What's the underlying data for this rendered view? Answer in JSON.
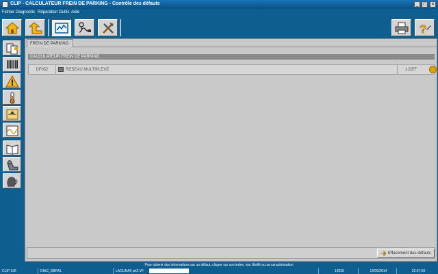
{
  "window": {
    "title": "CLIP - CALCULATEUR FREIN DE PARKING - Contrôle des défauts",
    "minimize": "_",
    "maximize": "□",
    "close": "×"
  },
  "menu": [
    "Fichier",
    "Diagnostic",
    "Réparation",
    "Outils",
    "Aide"
  ],
  "toolbar": {
    "icons": [
      "home-icon",
      "up-arrow-icon",
      "chart-icon",
      "probe-icon",
      "tools-icon",
      "printer-icon",
      "help-icon"
    ],
    "active": "chart-icon"
  },
  "sidebar": {
    "icons": [
      "documents-icon",
      "barcode-icon",
      "warning-icon",
      "thermometer-icon",
      "parameters-icon",
      "graph-icon",
      "book-icon",
      "repair-icon",
      "head-icon"
    ]
  },
  "tab": {
    "label": "FREIN DE PARKING"
  },
  "section": {
    "title": "CALCULATEUR FREIN DE PARKING"
  },
  "faults": [
    {
      "code": "DF052",
      "label": "RESEAU MULTIPLEXE",
      "status": "1.DEF",
      "color": "#e0a000"
    }
  ],
  "actions": {
    "clear_faults": "Effacement des défauts"
  },
  "info_text": "Pour obtenir des informations sur un défaut, cliquer sur son index, son libellé ou sa caractérisation",
  "status_bar": {
    "clip_version": "CLIP 136",
    "diag": "DIAC_DBFA1",
    "vehicle": "LAGUNAII ph2-VF",
    "code": "18235",
    "date": "12/05/2014",
    "time": "22:57:00"
  },
  "colors": {
    "background": "#0e5f8f",
    "panel": "#c9c9c9",
    "fault_indicator": "#e0a000"
  }
}
